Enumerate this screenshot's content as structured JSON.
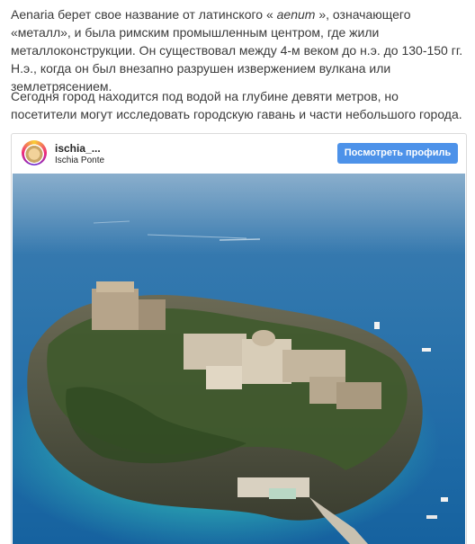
{
  "article": {
    "p1": {
      "before": "Aenaria берет свое название от латинского « ",
      "italic": "aenum",
      "after": " », означающего «металл», и была римским промышленным центром, где жили металлоконструкции. Он существовал между 4-м веком до н.э. до 130-150 гг. Н.э., когда он был внезапно разрушен извержением вулкана или землетрясением."
    },
    "p2": "Сегодня город находится под водой на глубине девяти метров, но посетители могут исследовать городскую гавань и части небольшого города."
  },
  "embed": {
    "account_name": "ischia_...",
    "location": "Ischia Ponte",
    "profile_button": "Посмотреть профиль",
    "photo_icon": "aerial-photo-castle-island"
  },
  "colors": {
    "button": "#4d92e9",
    "text": "#3a3a3a",
    "border": "#dbdbdb"
  }
}
